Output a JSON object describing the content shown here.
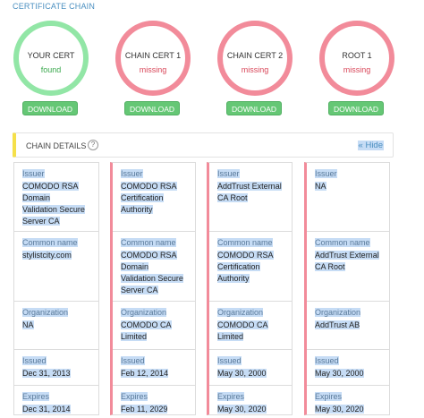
{
  "heading": "CERTIFICATE CHAIN",
  "certs": [
    {
      "name": "YOUR CERT",
      "status": "found",
      "button": "DOWNLOAD"
    },
    {
      "name": "CHAIN CERT 1",
      "status": "missing",
      "button": "DOWNLOAD"
    },
    {
      "name": "CHAIN CERT 2",
      "status": "missing",
      "button": "DOWNLOAD"
    },
    {
      "name": "ROOT 1",
      "status": "missing",
      "button": "DOWNLOAD"
    }
  ],
  "details": {
    "title": "CHAIN DETAILS",
    "help": "?",
    "hide": "« Hide"
  },
  "labels": {
    "issuer": "Issuer",
    "common_name": "Common name",
    "organization": "Organization",
    "issued": "Issued",
    "expires": "Expires"
  },
  "columns": [
    {
      "issuer": [
        "COMODO RSA",
        "Domain",
        "Validation Secure",
        "Server CA"
      ],
      "common_name": [
        "stylistcity.com"
      ],
      "organization": [
        "NA"
      ],
      "issued": "Dec 31, 2013",
      "expires": "Dec 31, 2014"
    },
    {
      "issuer": [
        "COMODO RSA",
        "Certification",
        "Authority"
      ],
      "common_name": [
        "COMODO RSA",
        "Domain",
        "Validation Secure",
        "Server CA"
      ],
      "organization": [
        "COMODO CA",
        "Limited"
      ],
      "issued": "Feb 12, 2014",
      "expires": "Feb 11, 2029"
    },
    {
      "issuer": [
        "AddTrust External",
        "CA Root"
      ],
      "common_name": [
        "COMODO RSA",
        "Certification",
        "Authority"
      ],
      "organization": [
        "COMODO CA",
        "Limited"
      ],
      "issued": "May 30, 2000",
      "expires": "May 30, 2020"
    },
    {
      "issuer": [
        "NA"
      ],
      "common_name": [
        "AddTrust External",
        "CA Root"
      ],
      "organization": [
        "AddTrust AB"
      ],
      "issued": "May 30, 2000",
      "expires": "May 30, 2020"
    }
  ]
}
